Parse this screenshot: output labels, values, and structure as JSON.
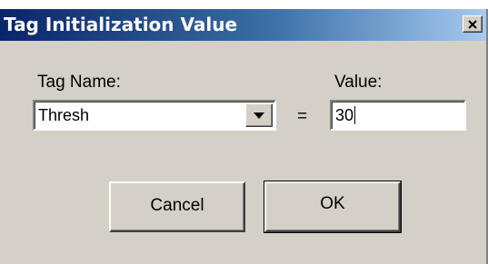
{
  "window": {
    "title": "Tag Initialization Value",
    "close_icon": "close-x-icon"
  },
  "form": {
    "tag_name_label": "Tag Name:",
    "tag_name_value": "Thresh",
    "dropdown_icon": "chevron-down-icon",
    "equals_sign": "=",
    "value_label": "Value:",
    "value_text": "30"
  },
  "buttons": {
    "cancel_label": "Cancel",
    "ok_label": "OK"
  }
}
